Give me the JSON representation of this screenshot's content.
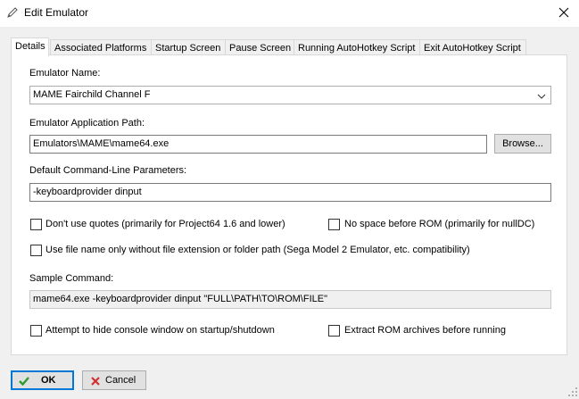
{
  "window": {
    "title": "Edit Emulator"
  },
  "tabs": [
    {
      "label": "Details"
    },
    {
      "label": "Associated Platforms"
    },
    {
      "label": "Startup Screen"
    },
    {
      "label": "Pause Screen"
    },
    {
      "label": "Running AutoHotkey Script"
    },
    {
      "label": "Exit AutoHotkey Script"
    }
  ],
  "details": {
    "name_label": "Emulator Name:",
    "name_value": "MAME Fairchild Channel F",
    "path_label": "Emulator Application Path:",
    "path_value": "Emulators\\MAME\\mame64.exe",
    "browse_label": "Browse...",
    "params_label": "Default Command-Line Parameters:",
    "params_value": "-keyboardprovider dinput",
    "no_quotes_label": "Don't use quotes (primarily for Project64 1.6 and lower)",
    "no_space_label": "No space before ROM (primarily for nullDC)",
    "file_name_only_label": "Use file name only without file extension or folder path (Sega Model 2 Emulator, etc. compatibility)",
    "sample_label": "Sample Command:",
    "sample_value": "mame64.exe -keyboardprovider dinput \"FULL\\PATH\\TO\\ROM\\FILE\"",
    "hide_console_label": "Attempt to hide console window on startup/shutdown",
    "extract_rom_label": "Extract ROM archives before running",
    "checkboxes": {
      "no_quotes": false,
      "no_space": false,
      "file_name_only": false,
      "hide_console": false,
      "extract_rom": false
    }
  },
  "footer": {
    "ok_label": "OK",
    "cancel_label": "Cancel"
  },
  "icons": {
    "title": "pencil-icon",
    "close": "close-icon",
    "ok": "checkmark-icon",
    "cancel": "x-icon",
    "combo": "chevron-down-icon"
  },
  "colors": {
    "accent": "#0078d7",
    "ok_check": "#2e9a2e",
    "cancel_x": "#d03030"
  }
}
